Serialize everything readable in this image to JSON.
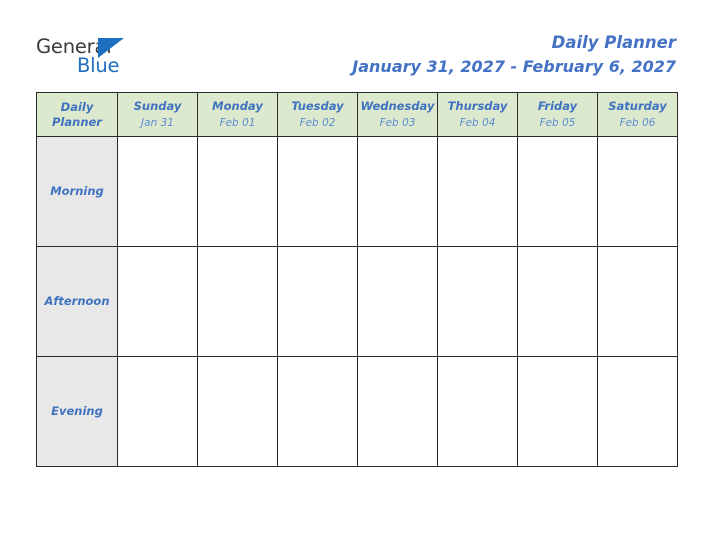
{
  "logo": {
    "word_one": "General",
    "word_two": "Blue",
    "triangle_icon": "triangle-icon",
    "word_one_color": "#3b3b3b",
    "word_two_color": "#1f6fc0",
    "triangle_color": "#1f6fc0"
  },
  "header": {
    "title": "Daily Planner",
    "date_range": "January 31, 2027 - February 6, 2027",
    "title_color": "#4472C4"
  },
  "table": {
    "corner": {
      "line1": "Daily",
      "line2": "Planner"
    },
    "header_bg": "#dde9ce",
    "row_label_bg": "#e8e8e8",
    "border_color": "#2a2a2a",
    "day_name_color": "#3f73c0",
    "day_date_color": "#5b8cd0",
    "columns": [
      {
        "day": "Sunday",
        "date": "Jan 31"
      },
      {
        "day": "Monday",
        "date": "Feb 01"
      },
      {
        "day": "Tuesday",
        "date": "Feb 02"
      },
      {
        "day": "Wednesday",
        "date": "Feb 03"
      },
      {
        "day": "Thursday",
        "date": "Feb 04"
      },
      {
        "day": "Friday",
        "date": "Feb 05"
      },
      {
        "day": "Saturday",
        "date": "Feb 06"
      }
    ],
    "rows": [
      {
        "label": "Morning",
        "cells": [
          "",
          "",
          "",
          "",
          "",
          "",
          ""
        ]
      },
      {
        "label": "Afternoon",
        "cells": [
          "",
          "",
          "",
          "",
          "",
          "",
          ""
        ]
      },
      {
        "label": "Evening",
        "cells": [
          "",
          "",
          "",
          "",
          "",
          "",
          ""
        ]
      }
    ]
  }
}
